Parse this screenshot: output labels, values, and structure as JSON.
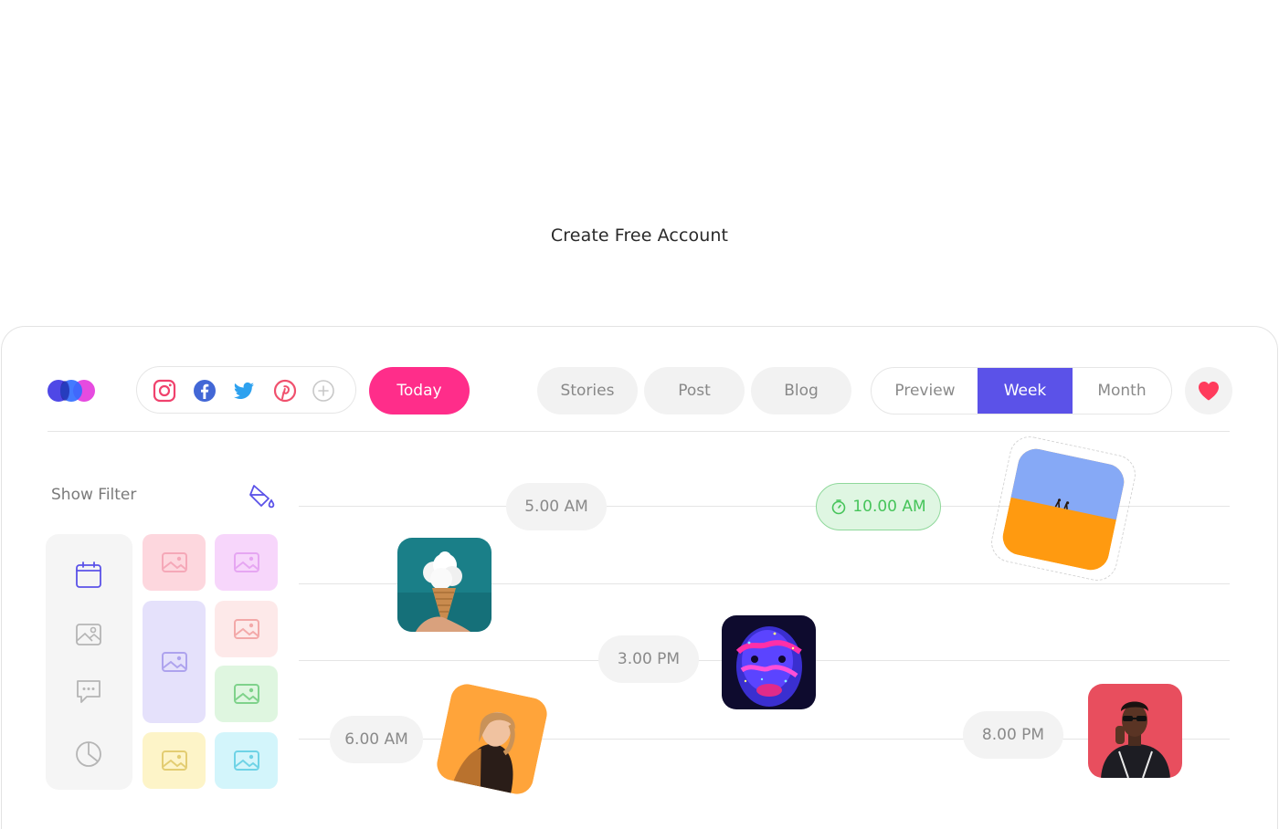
{
  "cta": {
    "label": "Create Free Account"
  },
  "toolbar": {
    "social_icons": [
      "instagram-icon",
      "facebook-icon",
      "twitter-icon",
      "pinterest-icon",
      "add-icon"
    ],
    "today_label": "Today",
    "content_types": [
      "Stories",
      "Post",
      "Blog"
    ],
    "views": [
      "Preview",
      "Week",
      "Month"
    ],
    "active_view": "Week",
    "favorite_icon": "heart-icon"
  },
  "filter": {
    "label": "Show Filter",
    "tool_icon": "paint-bucket-icon",
    "category_icons": [
      "calendar-icon",
      "image-icon",
      "chat-icon",
      "pie-chart-icon"
    ]
  },
  "timeline": {
    "slots": [
      {
        "label": "5.00 AM"
      },
      {
        "label": "10.00 AM",
        "timer_icon": "timer-icon"
      },
      {
        "label": "3.00 PM"
      },
      {
        "label": "6.00 AM"
      },
      {
        "label": "8.00 PM"
      }
    ]
  },
  "colors": {
    "accent_pink": "#ff2d8a",
    "accent_purple": "#5b52e8",
    "success_green": "#46c45a",
    "heart_red": "#ff3b5c"
  }
}
